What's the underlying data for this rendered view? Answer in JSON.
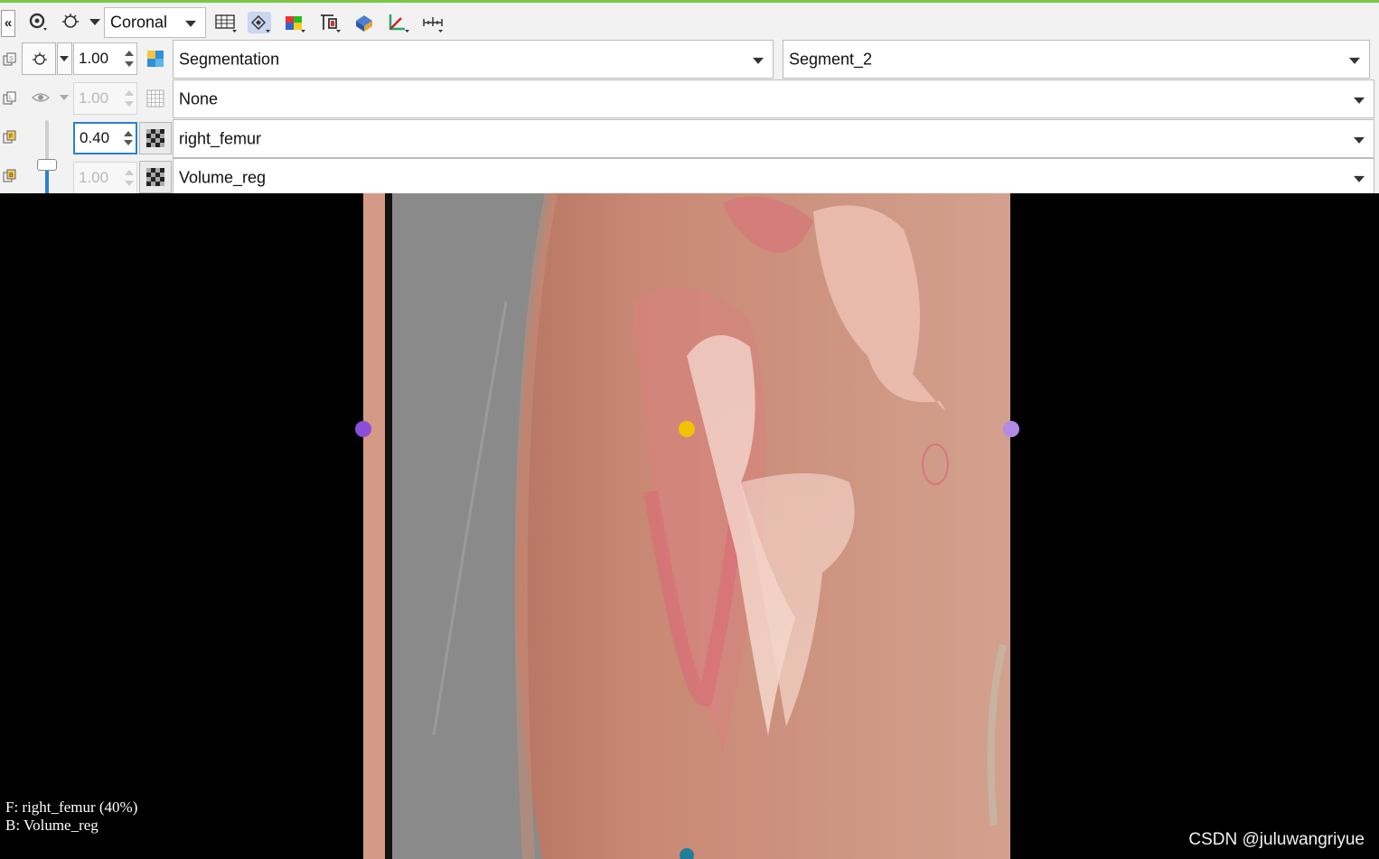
{
  "toolbar": {
    "collapse_label": "«",
    "orientation": "Coronal",
    "icons": [
      "link-icon",
      "eye-icon",
      "slice-layout-icon",
      "sync-pan-icon",
      "volume-3d-icon",
      "interpolation-icon",
      "crosshair-icon",
      "ruler-icon"
    ]
  },
  "layers": {
    "label": {
      "opacity": "1.00",
      "volume": "Segmentation",
      "segment": "Segment_2"
    },
    "outline": {
      "opacity": "1.00",
      "volume": "None"
    },
    "foreground": {
      "opacity": "0.40",
      "volume": "right_femur"
    },
    "background": {
      "opacity": "1.00",
      "volume": "Volume_reg"
    }
  },
  "viewer": {
    "fg_annotation": "F: right_femur (40%)",
    "bg_annotation": "B: Volume_reg",
    "watermark": "CSDN @juluwangriyue",
    "markers": [
      {
        "name": "left-handle",
        "color": "#8a4fd8"
      },
      {
        "name": "center-handle",
        "color": "#f2c200"
      },
      {
        "name": "right-handle",
        "color": "#b38ae6"
      },
      {
        "name": "bottom-handle",
        "color": "#1e7f9a"
      }
    ]
  },
  "colors": {
    "accent_green": "#7ac943",
    "focus_blue": "#2a7fd4",
    "slider_blue": "#2a7fd4"
  }
}
